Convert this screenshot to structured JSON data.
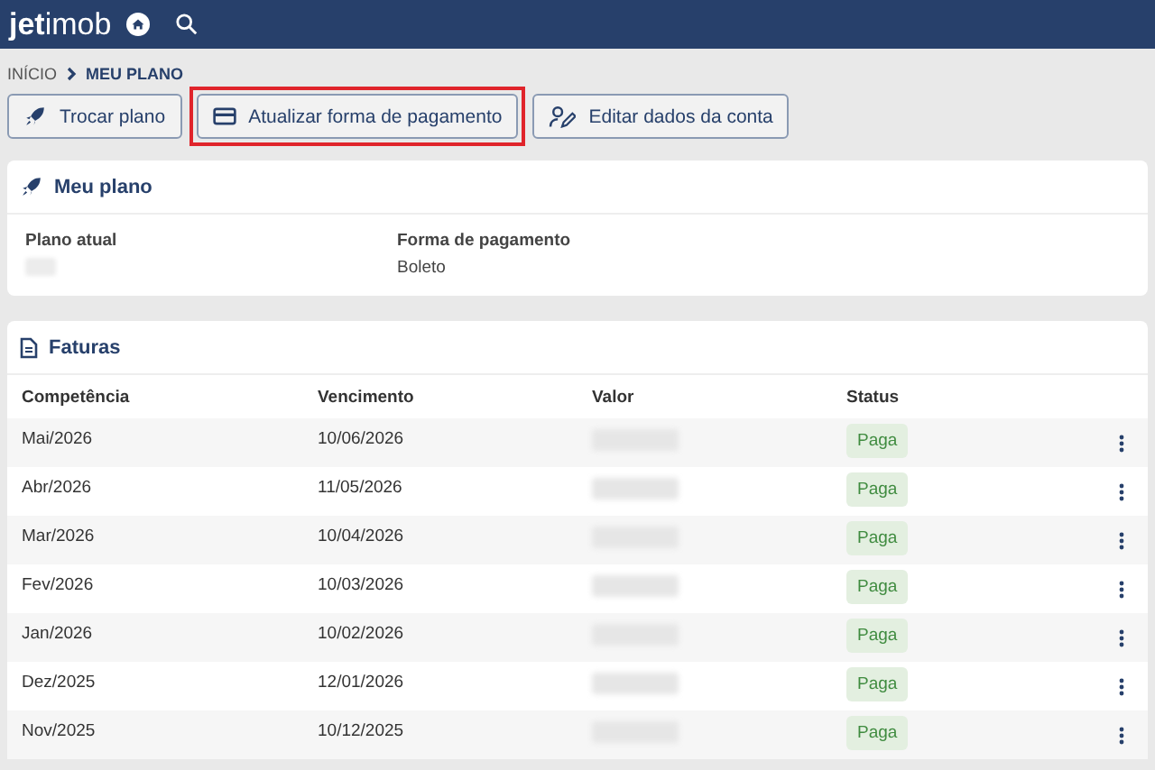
{
  "header": {
    "logo_bold": "jet",
    "logo_light": "imob"
  },
  "breadcrumb": [
    {
      "label": "INÍCIO",
      "current": false
    },
    {
      "label": "MEU PLANO",
      "current": true
    }
  ],
  "actions": [
    {
      "label": "Trocar plano",
      "highlighted": false
    },
    {
      "label": "Atualizar forma de pagamento",
      "highlighted": true
    },
    {
      "label": "Editar dados da conta",
      "highlighted": false
    }
  ],
  "plan_card": {
    "title": "Meu plano",
    "fields": [
      {
        "label": "Plano atual"
      },
      {
        "label": "Forma de pagamento",
        "value": "Boleto"
      }
    ]
  },
  "invoices": {
    "title": "Faturas",
    "columns": [
      "Competência",
      "Vencimento",
      "Valor",
      "Status"
    ],
    "rows": [
      {
        "competencia": "Mai/2026",
        "vencimento": "10/06/2026",
        "status": "Paga"
      },
      {
        "competencia": "Abr/2026",
        "vencimento": "11/05/2026",
        "status": "Paga"
      },
      {
        "competencia": "Mar/2026",
        "vencimento": "10/04/2026",
        "status": "Paga"
      },
      {
        "competencia": "Fev/2026",
        "vencimento": "10/03/2026",
        "status": "Paga"
      },
      {
        "competencia": "Jan/2026",
        "vencimento": "10/02/2026",
        "status": "Paga"
      },
      {
        "competencia": "Dez/2025",
        "vencimento": "12/01/2026",
        "status": "Paga"
      },
      {
        "competencia": "Nov/2025",
        "vencimento": "10/12/2025",
        "status": "Paga"
      }
    ]
  }
}
